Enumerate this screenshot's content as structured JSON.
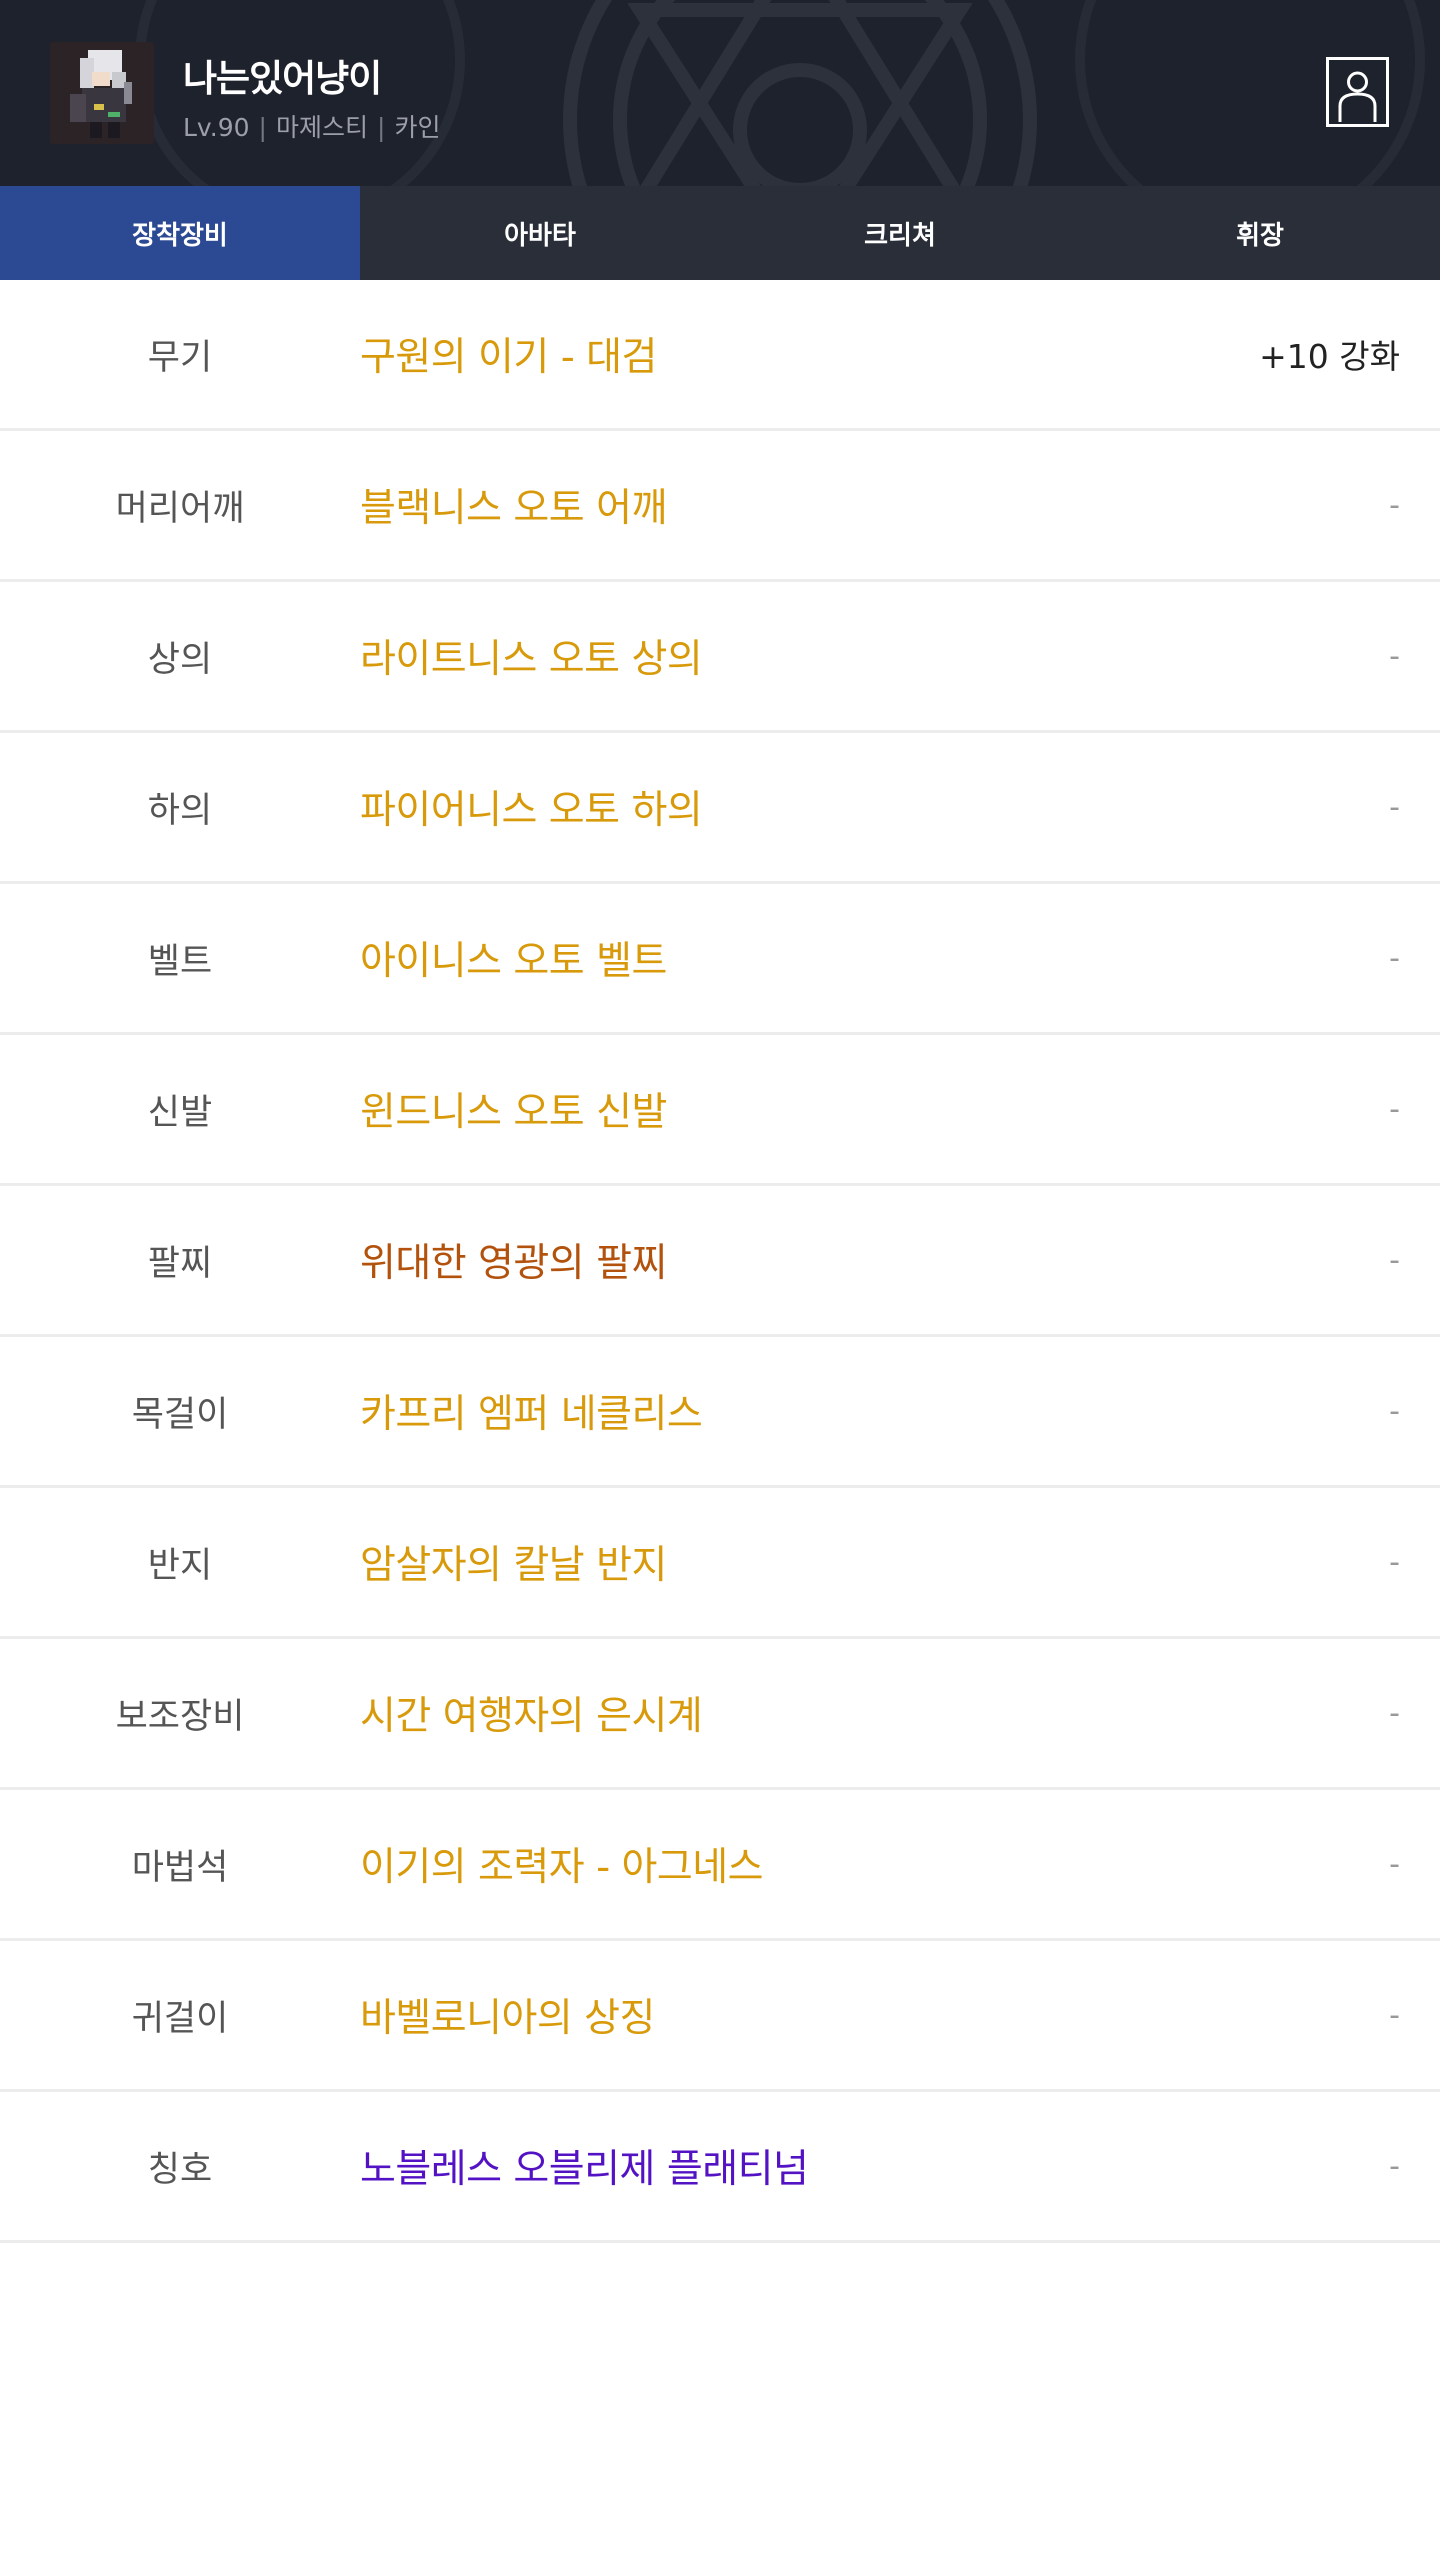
{
  "character": {
    "name": "나는있어냥이",
    "level": "Lv.90",
    "job": "마제스티",
    "server": "카인",
    "separator": "|"
  },
  "icons": {
    "profile_button": "person-icon",
    "avatar": "character-portrait"
  },
  "tabs": [
    {
      "label": "장착장비",
      "active": true
    },
    {
      "label": "아바타",
      "active": false
    },
    {
      "label": "크리쳐",
      "active": false
    },
    {
      "label": "휘장",
      "active": false
    }
  ],
  "colors": {
    "unique": "#d89a0a",
    "epic_red": "#b3520c",
    "legendary_purple": "#5312c4",
    "active_tab": "#2c4994",
    "header_bg": "#1e222c"
  },
  "equipment": [
    {
      "slot": "무기",
      "item": "구원의 이기 - 대검",
      "extra": "+10 강화",
      "rarity": "unique"
    },
    {
      "slot": "머리어깨",
      "item": "블랙니스 오토 어깨",
      "extra": "-",
      "rarity": "unique"
    },
    {
      "slot": "상의",
      "item": "라이트니스 오토 상의",
      "extra": "-",
      "rarity": "unique"
    },
    {
      "slot": "하의",
      "item": "파이어니스 오토 하의",
      "extra": "-",
      "rarity": "unique"
    },
    {
      "slot": "벨트",
      "item": "아이니스 오토 벨트",
      "extra": "-",
      "rarity": "unique"
    },
    {
      "slot": "신발",
      "item": "윈드니스 오토 신발",
      "extra": "-",
      "rarity": "unique"
    },
    {
      "slot": "팔찌",
      "item": "위대한 영광의 팔찌",
      "extra": "-",
      "rarity": "epic_red"
    },
    {
      "slot": "목걸이",
      "item": "카프리 엠퍼 네클리스",
      "extra": "-",
      "rarity": "unique"
    },
    {
      "slot": "반지",
      "item": "암살자의 칼날 반지",
      "extra": "-",
      "rarity": "unique"
    },
    {
      "slot": "보조장비",
      "item": "시간 여행자의 은시계",
      "extra": "-",
      "rarity": "unique"
    },
    {
      "slot": "마법석",
      "item": "이기의 조력자 - 아그네스",
      "extra": "-",
      "rarity": "unique"
    },
    {
      "slot": "귀걸이",
      "item": "바벨로니아의 상징",
      "extra": "-",
      "rarity": "unique"
    },
    {
      "slot": "칭호",
      "item": "노블레스 오블리제 플래티넘",
      "extra": "-",
      "rarity": "legendary_purple"
    }
  ]
}
